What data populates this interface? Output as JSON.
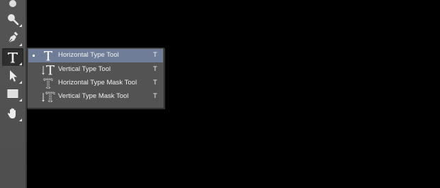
{
  "toolbar": {
    "tools": [
      {
        "icon": "clone-stamp-icon"
      },
      {
        "icon": "zoom-icon"
      },
      {
        "icon": "pen-icon"
      },
      {
        "icon": "type-icon",
        "active": true
      },
      {
        "icon": "selection-arrow-icon"
      },
      {
        "icon": "rectangle-icon"
      },
      {
        "icon": "hand-icon"
      }
    ]
  },
  "flyout": {
    "selected_color": "#6f7d98",
    "items": [
      {
        "label": "Horizontal Type Tool",
        "shortcut": "T",
        "icon": "horizontal-type-icon",
        "selected": true
      },
      {
        "label": "Vertical Type Tool",
        "shortcut": "T",
        "icon": "vertical-type-icon",
        "selected": false
      },
      {
        "label": "Horizontal Type Mask Tool",
        "shortcut": "T",
        "icon": "horizontal-type-mask-icon",
        "selected": false
      },
      {
        "label": "Vertical Type Mask Tool",
        "shortcut": "T",
        "icon": "vertical-type-mask-icon",
        "selected": false
      }
    ]
  }
}
